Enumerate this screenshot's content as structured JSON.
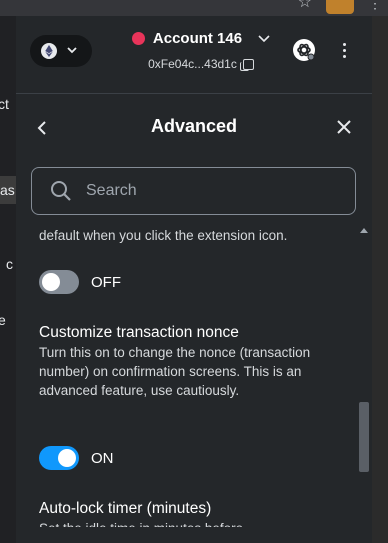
{
  "browser": {
    "star_icon": "star-outline-icon",
    "extension_icon": "metamask-fox-icon",
    "page_fragments": [
      "ct",
      "as",
      "c",
      "e"
    ]
  },
  "header": {
    "network_icon": "ethereum-icon",
    "account_name": "Account 146",
    "address": "0xFe04c...43d1c",
    "avatar_color": "#e8345a"
  },
  "settings": {
    "title": "Advanced",
    "search_placeholder": "Search"
  },
  "content": {
    "cut_text": "default when you click the extension icon.",
    "toggle1": {
      "label": "OFF",
      "on": false
    },
    "nonce": {
      "title": "Customize transaction nonce",
      "description": "Turn this on to change the nonce (transaction number) on confirmation screens. This is an advanced feature, use cautiously."
    },
    "toggle2": {
      "label": "ON",
      "on": true
    },
    "autolock": {
      "title": "Auto-lock timer (minutes)",
      "description": "Set the idle time in minutes before"
    }
  },
  "colors": {
    "accent": "#1098fc",
    "background": "#24272a",
    "toggle_off": "#848c96"
  }
}
